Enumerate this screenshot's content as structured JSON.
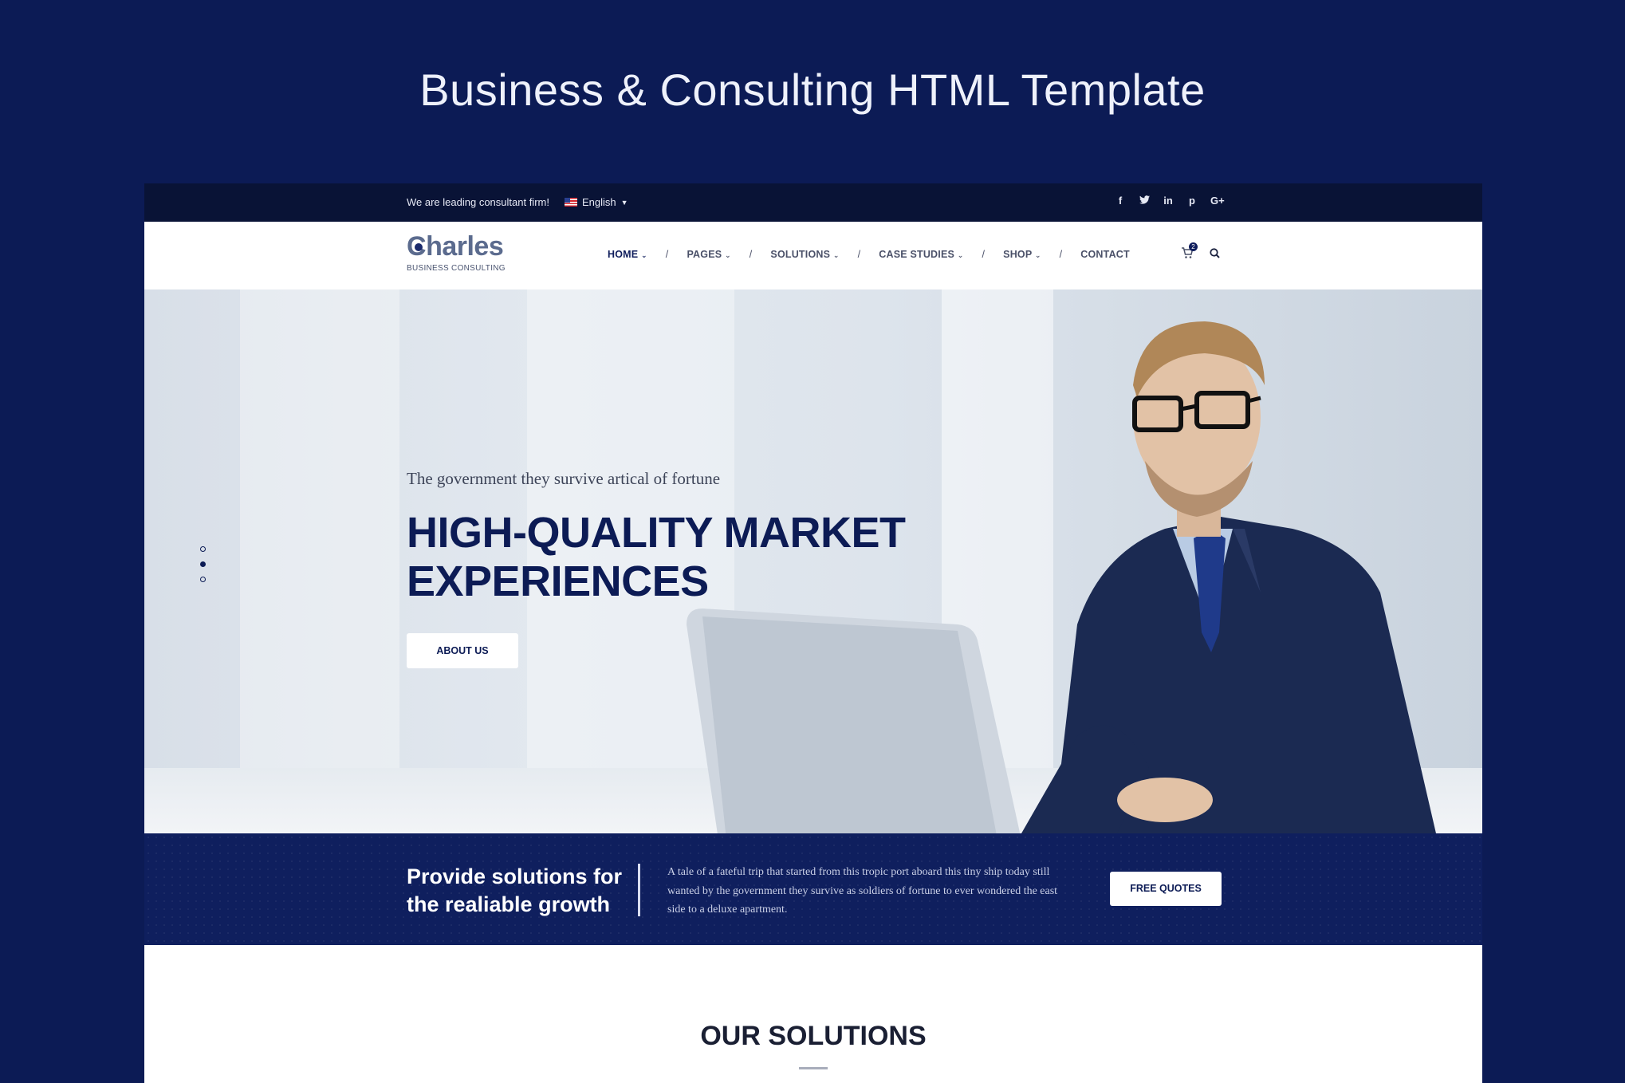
{
  "showcase": {
    "title": "Business & Consulting HTML Template"
  },
  "topbar": {
    "tagline": "We are leading consultant firm!",
    "language": "English",
    "socials": [
      "f",
      "t",
      "in",
      "p",
      "G+"
    ]
  },
  "header": {
    "logo": {
      "word": "harles",
      "letter": "C",
      "subtitle": "BUSINESS CONSULTING"
    },
    "nav": {
      "home": "HOME",
      "pages": "PAGES",
      "solutions": "SOLUTIONS",
      "case_studies": "CASE STUDIES",
      "shop": "SHOP",
      "contact": "CONTACT",
      "separator": "/"
    },
    "cart_count": "2"
  },
  "hero": {
    "kicker": "The government they survive artical of fortune",
    "headline_line1": "HIGH-QUALITY MARKET",
    "headline_line2": "EXPERIENCES",
    "button": "ABOUT US",
    "active_slide": 2,
    "slide_count": 3
  },
  "strip": {
    "heading_line1": "Provide solutions for",
    "heading_line2": "the realiable growth",
    "text": "A tale of a fateful trip that started from this tropic port aboard this tiny ship today still wanted by the government they survive as soldiers of fortune to ever wondered the east side to a deluxe apartment.",
    "button": "FREE QUOTES"
  },
  "solutions": {
    "title": "OUR SOLUTIONS"
  },
  "colors": {
    "navy": "#0c1b55",
    "topbar": "#091336",
    "strip": "#0f1f5e"
  }
}
